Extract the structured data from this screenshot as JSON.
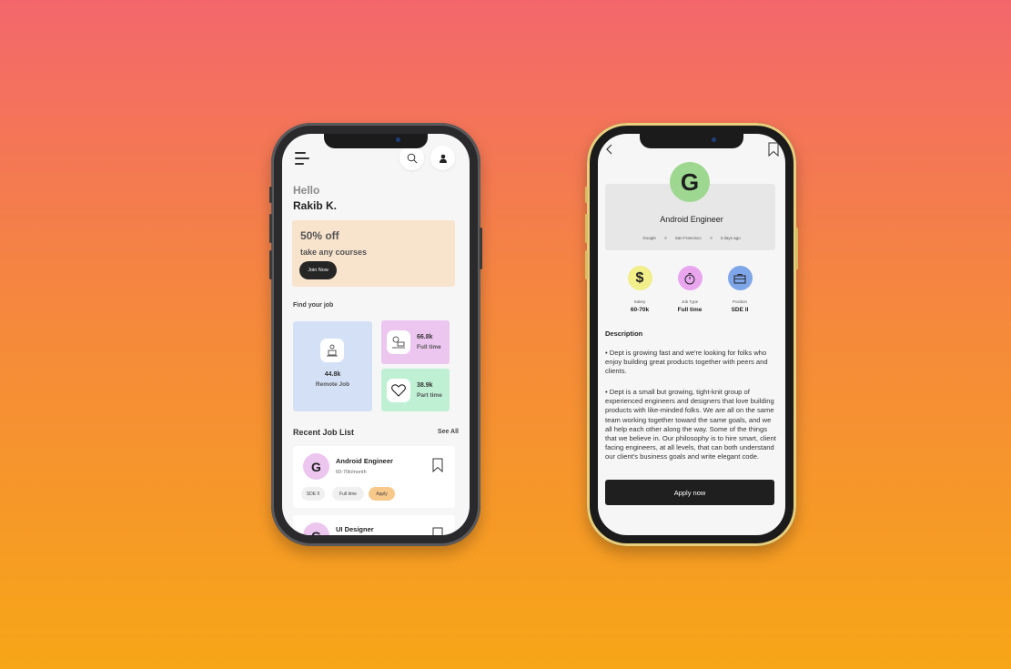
{
  "home": {
    "greeting": "Hello",
    "user_name": "Rakib K.",
    "promo": {
      "title": "50% off",
      "subtitle": "take any courses",
      "button": "Join Now",
      "bg_color": "#f8e3cc"
    },
    "find_job_label": "Find your job",
    "job_stats": [
      {
        "count": "44.8k",
        "label": "Remote Job",
        "icon": "remote-work-icon",
        "color": "#d4e0f6"
      },
      {
        "count": "66.8k",
        "label": "Full time",
        "icon": "full-time-icon",
        "color": "#ecc6ef"
      },
      {
        "count": "38.9k",
        "label": "Part time",
        "icon": "heart-icon",
        "color": "#bff0d4"
      }
    ],
    "recent": {
      "title": "Recent Job List",
      "see_all": "See All",
      "jobs": [
        {
          "logo": "G",
          "title": "Android Engineer",
          "pay": "60-70k/month",
          "tags": [
            "SDE II",
            "Full time",
            "Apply"
          ]
        },
        {
          "logo": "G",
          "title": "UI Designer"
        }
      ]
    }
  },
  "detail": {
    "company_logo": "G",
    "title": "Android Engineer",
    "meta": [
      "Google",
      "San Francisco",
      "3 days ago"
    ],
    "stats": [
      {
        "label": "Salary",
        "value": "60-70k",
        "icon": "dollar-icon",
        "color": "#f2ee8a"
      },
      {
        "label": "Job Type",
        "value": "Full time",
        "icon": "stopwatch-icon",
        "color": "#e9a6ef"
      },
      {
        "label": "Position",
        "value": "SDE II",
        "icon": "briefcase-icon",
        "color": "#7ea6e8"
      }
    ],
    "description_title": "Description",
    "description": [
      "•  Dept is growing fast and we're looking for folks who enjoy building great products together with peers and clients.",
      "•  Dept is a small but growing, tight-knit group of experienced engineers and designers that love building products with like-minded folks. We are all on the same team working together toward the same goals, and we all help each other along the way. Some of the things that we believe in. Our philosophy is to hire smart, client facing engineers, at all levels, that can both understand our client's business goals and write elegant code."
    ],
    "apply_button": "Apply now"
  }
}
